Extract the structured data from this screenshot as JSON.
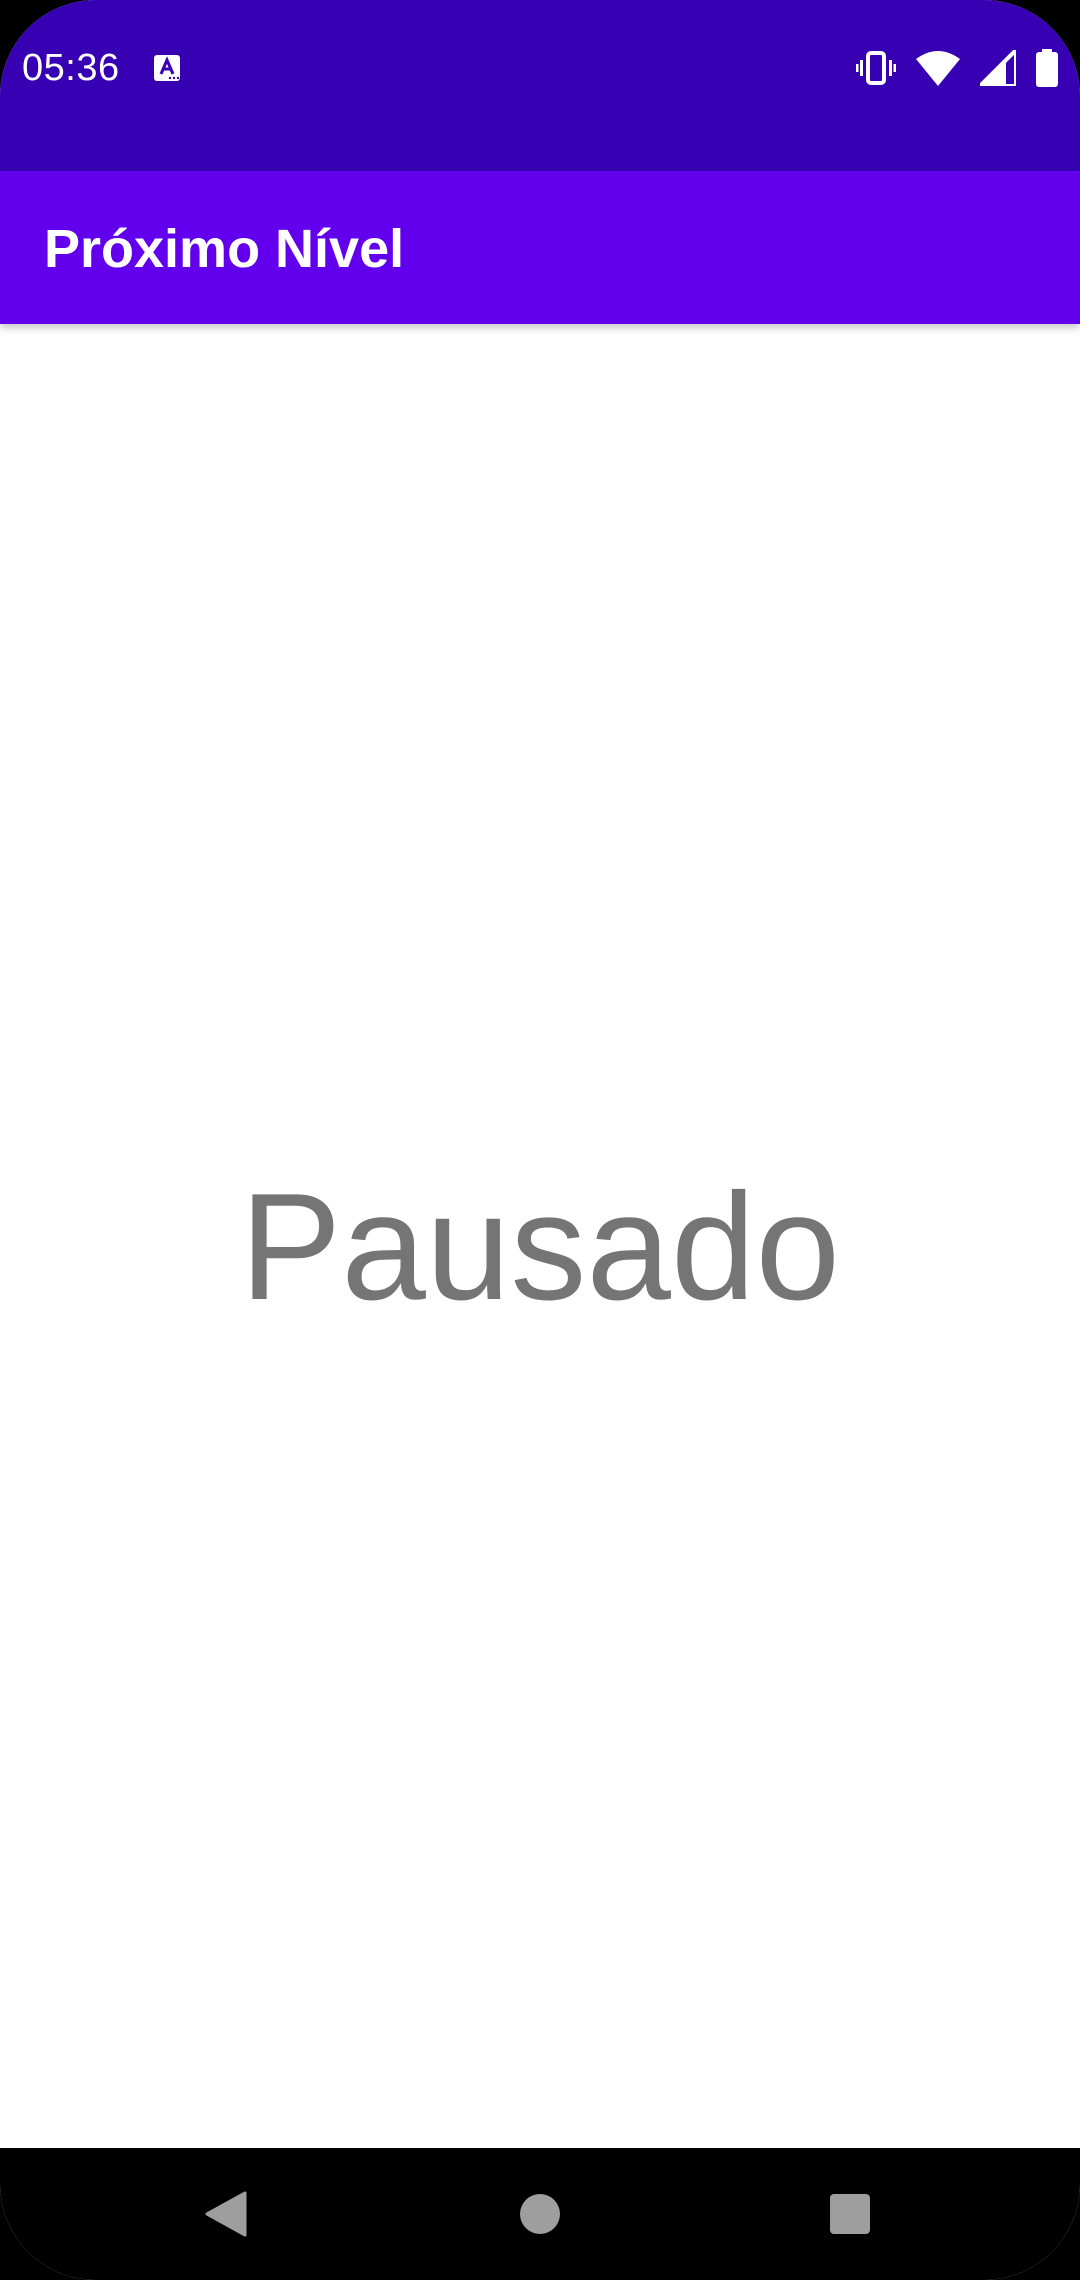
{
  "status_bar": {
    "time": "05:36",
    "icons": [
      "autofill-notification-icon",
      "vibrate-icon",
      "wifi-icon",
      "cell-signal-icon",
      "battery-icon"
    ]
  },
  "app_bar": {
    "title": "Próximo Nível"
  },
  "main": {
    "status_text": "Pausado"
  },
  "nav_bar": {
    "buttons": [
      "back-icon",
      "home-icon",
      "recents-icon"
    ]
  },
  "colors": {
    "status_bar": "#3700b3",
    "app_bar": "#6200ee",
    "status_text": "#757575",
    "background": "#ffffff",
    "nav_bar": "#000000"
  }
}
